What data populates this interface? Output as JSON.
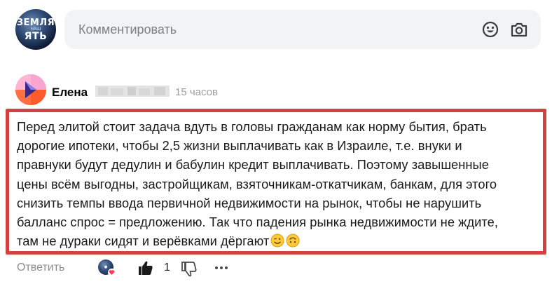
{
  "comment_bar": {
    "avatar_text_top": "ЗЕМЛЯ",
    "avatar_text_mid": "НАШ",
    "avatar_text_bottom": "ЯТЬ",
    "placeholder": "Комментировать",
    "emoji_icon": "emoji-icon",
    "camera_icon": "camera-icon"
  },
  "comment": {
    "author": "Елена",
    "time": "15 часов",
    "lines": [
      "Перед элитой стоит задача вдуть в головы гражданам как норму бытия, брать",
      "дорогие ипотеки, чтобы 2,5 жизни выплачивать как в Израиле, т.е. внуки и",
      "правнуки будут дедулин и бабулин кредит выплачивать. Поэтому завышенные",
      "цены всём выгодны, застройщикам, взяточникам-откатчикам, банкам, для этого",
      "снизить темпы ввода первичной недвижимости на рынок, чтобы не нарушить",
      "балланс спрос = предложению. Так что падения рынка недвижимости не ждите,",
      "там не дураки сидят и верёвками дёргают"
    ],
    "highlight_color": "#d2433f"
  },
  "actions": {
    "reply_label": "Ответить",
    "like_count": "1"
  }
}
